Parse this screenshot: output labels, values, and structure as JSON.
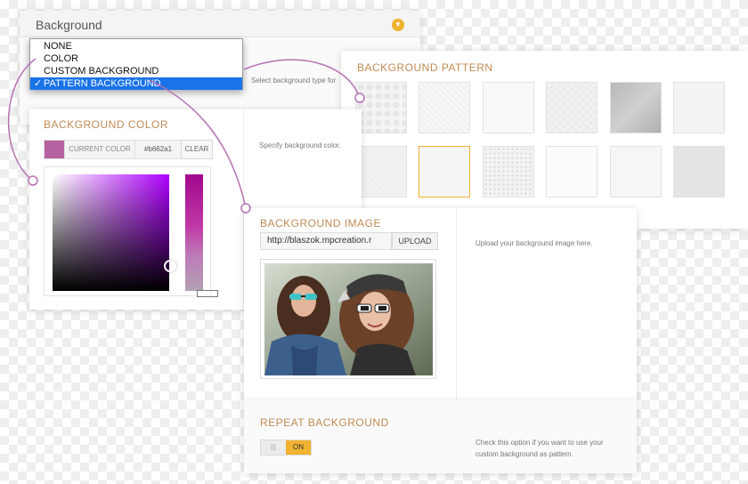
{
  "background_panel": {
    "title": "Background",
    "hint": "Select background type for",
    "dropdown": {
      "options": [
        "NONE",
        "COLOR",
        "CUSTOM BACKGROUND",
        "PATTERN BACKGROUND"
      ],
      "selected": "PATTERN BACKGROUND",
      "check_mark": "✓"
    }
  },
  "pattern_panel": {
    "title": "BACKGROUND PATTERN",
    "tiles": [
      {
        "name": "circles-pattern",
        "color": "#f4f4f4"
      },
      {
        "name": "diagonal-lines-pattern",
        "color": "#f7f7f7"
      },
      {
        "name": "plain-light-pattern",
        "color": "#f9f9f9"
      },
      {
        "name": "crosshatch-pattern",
        "color": "#f2f2f2"
      },
      {
        "name": "dark-triangles-pattern",
        "color": "#c4c4c4"
      },
      {
        "name": "soft-noise-pattern",
        "color": "#f3f3f3"
      },
      {
        "name": "linen-pattern",
        "color": "#f2f2f2"
      },
      {
        "name": "fine-weave-pattern",
        "color": "#f5f5f5"
      },
      {
        "name": "dotted-grid-pattern",
        "color": "#f3f3f3"
      },
      {
        "name": "plain-white-pattern",
        "color": "#fbfbfb"
      },
      {
        "name": "pinstripe-pattern",
        "color": "#f6f6f6"
      },
      {
        "name": "gray-noise-pattern",
        "color": "#e4e4e4"
      }
    ],
    "selected_index": 7
  },
  "color_panel": {
    "title": "BACKGROUND COLOR",
    "current_label": "CURRENT COLOR",
    "hex_value": "#b662a1",
    "clear_label": "CLEAR",
    "hint": "Specify background color.",
    "swatch_color": "#b662a1"
  },
  "image_panel": {
    "title": "BACKGROUND IMAGE",
    "url_value": "http://blaszok.mpcreation.r",
    "upload_label": "UPLOAD",
    "hint": "Upload your background image here."
  },
  "repeat_panel": {
    "title": "REPEAT BACKGROUND",
    "toggle_off": "|||",
    "toggle_on": "ON",
    "toggle_state": "on",
    "hint_line1": "Check this option if you want to use your",
    "hint_line2": "custom background as pattern."
  },
  "colors": {
    "accent": "#f0b230",
    "title_text": "#c08a54",
    "connector": "#b672b0",
    "select_highlight": "#1a73e8"
  }
}
